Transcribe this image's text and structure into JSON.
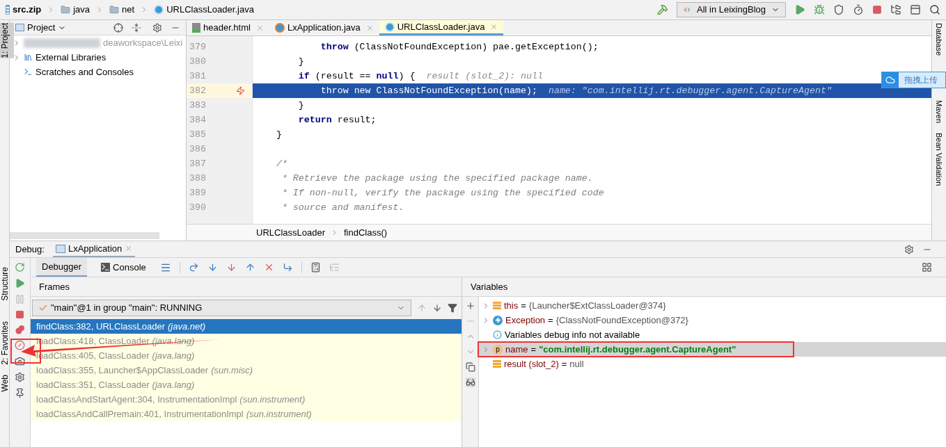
{
  "breadcrumbs": [
    {
      "kind": "archive",
      "label": "src.zip"
    },
    {
      "kind": "folder",
      "label": "java"
    },
    {
      "kind": "folder",
      "label": "net"
    },
    {
      "kind": "class",
      "label": "URLClassLoader.java"
    }
  ],
  "run_config": "All in LeixingBlog",
  "left_strip": {
    "project": "1: Project",
    "structure": "Structure",
    "favorites": "2: Favorites",
    "web": "Web"
  },
  "right_strip": [
    "Database",
    "Maven",
    "Bean Validation"
  ],
  "upload_widget": "拖拽上传",
  "project_panel": {
    "title": "Project",
    "tree": [
      {
        "kind": "module",
        "label": "deaworkspace\\Leixi"
      },
      {
        "kind": "libraries",
        "label": "External Libraries"
      },
      {
        "kind": "scratches",
        "label": "Scratches and Consoles"
      }
    ]
  },
  "editor_tabs": [
    {
      "kind": "html",
      "label": "header.html",
      "selected": false
    },
    {
      "kind": "run",
      "label": "LxApplication.java",
      "selected": false
    },
    {
      "kind": "class",
      "label": "URLClassLoader.java",
      "selected": true
    }
  ],
  "code_lines": [
    {
      "number": "379",
      "current": false,
      "tokens": [
        {
          "kind": "keyword",
          "text": "            throw"
        },
        {
          "kind": "plain",
          "text": " (ClassNotFoundException) pae.getException();"
        }
      ]
    },
    {
      "number": "380",
      "current": false,
      "tokens": [
        {
          "kind": "plain",
          "text": "        }"
        }
      ]
    },
    {
      "number": "381",
      "current": false,
      "tokens": [
        {
          "kind": "keyword",
          "text": "        if"
        },
        {
          "kind": "plain",
          "text": " (result == "
        },
        {
          "kind": "keyword",
          "text": "null"
        },
        {
          "kind": "plain",
          "text": ") {"
        },
        {
          "kind": "hint",
          "text": "  result (slot_2): null"
        }
      ]
    },
    {
      "number": "382",
      "current": true,
      "exception_breakpoint": true,
      "tokens": [
        {
          "kind": "keyword",
          "text": "            throw new"
        },
        {
          "kind": "plain",
          "text": " ClassNotFoundException(name);"
        },
        {
          "kind": "hint",
          "text": "  name: \"com.intellij.rt.debugger.agent.CaptureAgent\""
        }
      ]
    },
    {
      "number": "383",
      "current": false,
      "tokens": [
        {
          "kind": "plain",
          "text": "        }"
        }
      ]
    },
    {
      "number": "384",
      "current": false,
      "tokens": [
        {
          "kind": "keyword",
          "text": "        return"
        },
        {
          "kind": "plain",
          "text": " result;"
        }
      ]
    },
    {
      "number": "385",
      "current": false,
      "tokens": [
        {
          "kind": "plain",
          "text": "    }"
        }
      ]
    },
    {
      "number": "386",
      "current": false
    },
    {
      "number": "387",
      "current": false,
      "tokens": [
        {
          "kind": "comment",
          "text": "    /*"
        }
      ]
    },
    {
      "number": "388",
      "current": false,
      "tokens": [
        {
          "kind": "comment",
          "text": "     * Retrieve the package using the specified package name."
        }
      ]
    },
    {
      "number": "389",
      "current": false,
      "tokens": [
        {
          "kind": "comment",
          "text": "     * If non-null, verify the package using the specified code"
        }
      ]
    },
    {
      "number": "390",
      "current": false,
      "tokens": [
        {
          "kind": "comment",
          "text": "     * source and manifest."
        }
      ]
    }
  ],
  "editor_breadcrumbs": [
    "URLClassLoader",
    "findClass()"
  ],
  "debug": {
    "label": "Debug:",
    "session": "LxApplication",
    "tabs": [
      {
        "kind": "debugger",
        "label": "Debugger",
        "selected": true
      },
      {
        "kind": "console",
        "label": "Console",
        "selected": false
      }
    ],
    "frames_title": "Frames",
    "variables_title": "Variables",
    "thread": "\"main\"@1 in group \"main\": RUNNING",
    "frames": [
      {
        "method": "findClass:382, URLClassLoader",
        "package": "(java.net)",
        "selected": true
      },
      {
        "method": "loadClass:418, ClassLoader",
        "package": "(java.lang)",
        "selected": false
      },
      {
        "method": "loadClass:405, ClassLoader",
        "package": "(java.lang)",
        "selected": false
      },
      {
        "method": "loadClass:355, Launcher$AppClassLoader",
        "package": "(sun.misc)",
        "selected": false
      },
      {
        "method": "loadClass:351, ClassLoader",
        "package": "(java.lang)",
        "selected": false
      },
      {
        "method": "loadClassAndStartAgent:304, InstrumentationImpl",
        "package": "(sun.instrument)",
        "selected": false
      },
      {
        "method": "loadClassAndCallPremain:401, InstrumentationImpl",
        "package": "(sun.instrument)",
        "selected": false
      }
    ],
    "variables": [
      {
        "kind": "field",
        "name": "this",
        "operator": "=",
        "value": "{Launcher$ExtClassLoader@374}",
        "expandable": true,
        "selected": false
      },
      {
        "kind": "exception",
        "name": "Exception",
        "operator": "=",
        "value": "{ClassNotFoundException@372}",
        "expandable": true,
        "selected": false
      },
      {
        "kind": "info",
        "name": "Variables debug info not available",
        "expandable": false,
        "selected": false
      },
      {
        "kind": "param",
        "icon_letter": "p",
        "name": "name",
        "operator": "=",
        "value": "\"com.intellij.rt.debugger.agent.CaptureAgent\"",
        "expandable": true,
        "selected": true
      },
      {
        "kind": "field",
        "name": "result (slot_2)",
        "operator": "=",
        "value": "null",
        "expandable": false,
        "selected": false
      }
    ]
  }
}
